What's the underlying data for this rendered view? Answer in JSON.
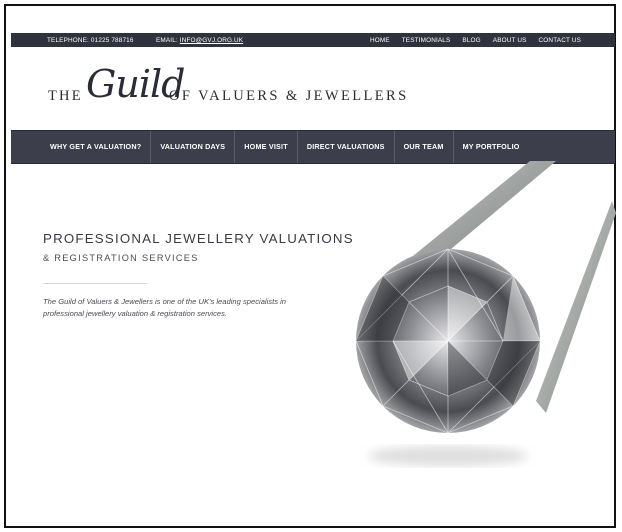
{
  "topbar": {
    "telephone": "TELEPHONE: 01225 788716",
    "email_label": "EMAIL:",
    "email_value": "INFO@GVJ.ORG.UK",
    "nav": [
      "HOME",
      "TESTIMONIALS",
      "BLOG",
      "ABOUT US",
      "CONTACT US"
    ]
  },
  "logo": {
    "the": "THE",
    "guild": "Guild",
    "rest": "OF VALUERS & JEWELLERS"
  },
  "mainnav": [
    "WHY GET A VALUATION?",
    "VALUATION DAYS",
    "HOME VISIT",
    "DIRECT VALUATIONS",
    "OUR TEAM",
    "MY PORTFOLIO"
  ],
  "hero": {
    "title": "PROFESSIONAL JEWELLERY VALUATIONS",
    "subtitle": "& REGISTRATION SERVICES",
    "text": "The Guild of Valuers & Jewellers is one of the UK's leading specialists in professional jewellery valuation & registration services."
  },
  "colors": {
    "bar_dark": "#30333d",
    "nav_bg": "#3c3f4b",
    "text_dark": "#3a3a44"
  }
}
